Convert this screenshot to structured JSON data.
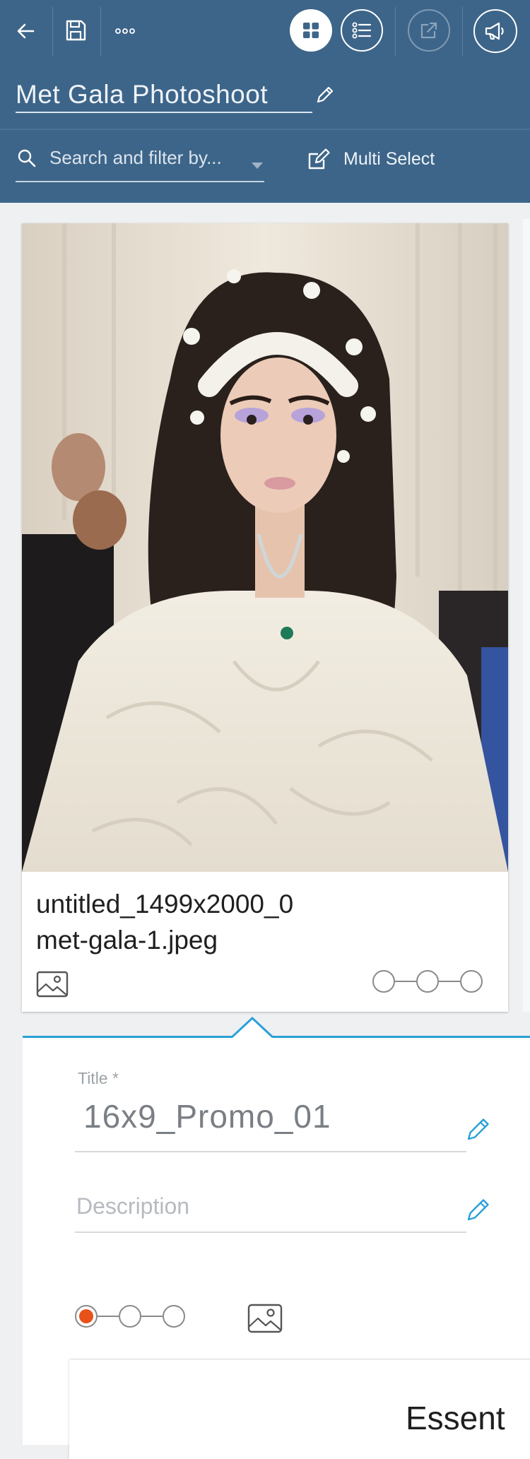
{
  "toolbar": {
    "back_icon": "arrow-left-icon",
    "save_icon": "floppy-disk-icon",
    "more_icon": "ellipsis-icon",
    "grid_icon": "grid-view-icon",
    "list_icon": "list-view-icon",
    "export_icon": "external-link-icon",
    "announce_icon": "megaphone-icon"
  },
  "project": {
    "title": "Met Gala Photoshoot"
  },
  "search": {
    "placeholder": "Search and filter by..."
  },
  "multi_select": {
    "label": "Multi Select"
  },
  "asset": {
    "filename_line1": "untitled_1499x2000_0",
    "filename_line2": "met-gala-1.jpeg",
    "type_icon": "image-icon"
  },
  "details": {
    "title_label": "Title *",
    "title_value": "16x9_Promo_01",
    "description_placeholder": "Description",
    "partial_heading": "Essent"
  },
  "colors": {
    "header_bg": "#3d6589",
    "accent": "#2aa0d8",
    "active_step": "#e8521a"
  }
}
